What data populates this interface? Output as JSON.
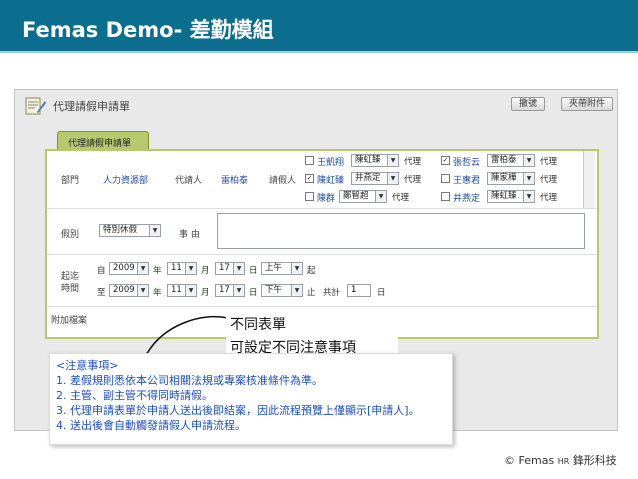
{
  "slide": {
    "title": "Femas Demo- 差勤模組",
    "footer_brand": "© Femas ",
    "footer_hr": "HR",
    "footer_company": " 鋒形科技"
  },
  "window": {
    "title": "代理請假申請單",
    "buttons": [
      "撤號",
      "夾帶附件"
    ],
    "tab": "代理請假申請單"
  },
  "form": {
    "dept_label": "部門",
    "dept_value": "人力資源部",
    "agent_label": "代請人",
    "agent_value": "雷柏泰",
    "leave_person_label": "請假人",
    "proxy_word": "代理",
    "people": [
      {
        "name": "王凱翔",
        "checked": false,
        "proxy": "陳虹臻"
      },
      {
        "name": "張哲云",
        "checked": true,
        "proxy": "雷柏泰"
      },
      {
        "name": "陳虹臻",
        "checked": true,
        "proxy": "井燕定"
      },
      {
        "name": "王惠君",
        "checked": false,
        "proxy": "陳家樺"
      },
      {
        "name": "陳群",
        "checked": false,
        "proxy": "鄭智超"
      },
      {
        "name": "井燕定",
        "checked": false,
        "proxy": "陳虹臻"
      }
    ],
    "leave_type_label": "假別",
    "leave_type_value": "特別休假",
    "reason_label": "事 由",
    "period_label_1": "起迄",
    "period_label_2": "時間",
    "from_word": "自",
    "to_word": "至",
    "year_unit": "年",
    "month_unit": "月",
    "day_unit": "日",
    "start_word": "起",
    "end_word": "止",
    "total_word": "共計",
    "start": {
      "year": "2009",
      "month": "11",
      "day": "17",
      "ampm": "上午"
    },
    "end": {
      "year": "2009",
      "month": "11",
      "day": "17",
      "ampm": "下午"
    },
    "total_days": "1",
    "attach_label": "附加檔案"
  },
  "callout": {
    "line1": "不同表單",
    "line2": "可設定不同注意事項"
  },
  "notice": {
    "heading": "<注意事項>",
    "items": [
      "1. 差假規則悉依本公司相關法規或專案核准條件為準。",
      "2. 主管、副主管不得同時請假。",
      "3. 代理申請表單於申請人送出後即結案，因此流程預覽上僅顯示[申請人]。",
      "4. 送出後會自動觸發請假人申請流程。"
    ]
  },
  "colors": {
    "header_bg": "#0b6e8e",
    "tab_green": "#b8c96b",
    "link_blue": "#1f4ea0",
    "notice_blue": "#1b4fbf"
  }
}
